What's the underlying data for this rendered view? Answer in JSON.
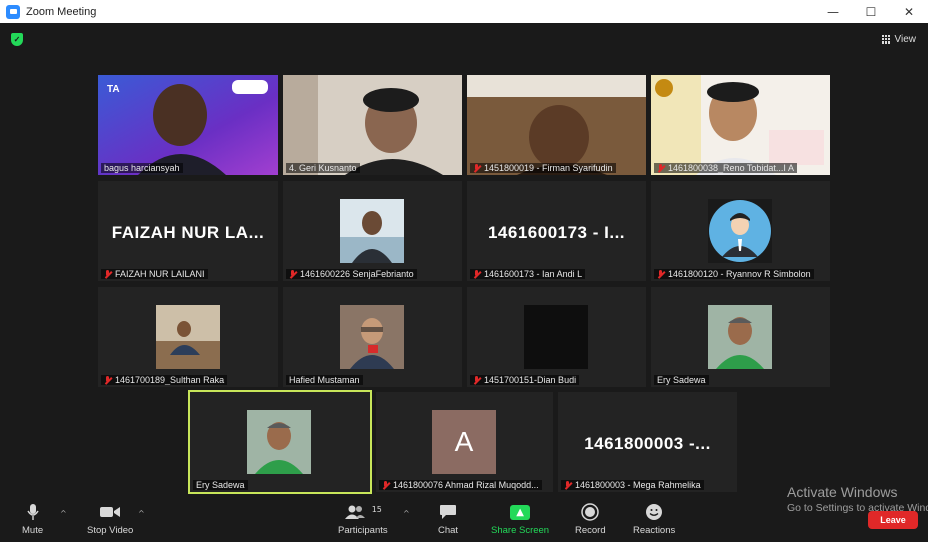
{
  "window": {
    "title": "Zoom Meeting",
    "controls": [
      "—",
      "☐",
      "✕"
    ]
  },
  "header": {
    "view_label": "View",
    "shield_icon": "shield-check-icon"
  },
  "participants": [
    {
      "name": "bagus harciansyah",
      "muted": false
    },
    {
      "name": "4. Geri Kusnanto",
      "muted": false
    },
    {
      "name": "1451800019 - Firman Syarifudin",
      "muted": true
    },
    {
      "name": "1461800038_Reno Tobidat...I A",
      "muted": true
    },
    {
      "name": "FAIZAH NUR LAILANI",
      "muted": true,
      "display": "FAIZAH NUR LA..."
    },
    {
      "name": "1461600226 SenjaFebrianto",
      "muted": true
    },
    {
      "name": "1461600173 - Ian Andi L",
      "muted": true,
      "display": "1461600173 - I..."
    },
    {
      "name": "1461800120 - Ryannov R Simbolon",
      "muted": true
    },
    {
      "name": "1461700189_Sulthan Raka",
      "muted": true
    },
    {
      "name": "Hafied Mustaman",
      "muted": false
    },
    {
      "name": "1451700151-Dian Budi",
      "muted": true
    },
    {
      "name": "Ery Sadewa",
      "muted": false
    },
    {
      "name": "Ery Sadewa",
      "muted": false,
      "active_speaker": true
    },
    {
      "name": "1461800076 Ahmad Rizal Muqodd...",
      "muted": true,
      "avatar_letter": "A"
    },
    {
      "name": "1461800003 - Mega Rahmelika",
      "muted": true,
      "display": "1461800003 -..."
    }
  ],
  "toolbar": {
    "mute": "Mute",
    "stop_video": "Stop Video",
    "participants": "Participants",
    "participants_count": "15",
    "chat": "Chat",
    "share_screen": "Share Screen",
    "record": "Record",
    "reactions": "Reactions",
    "leave": "Leave"
  },
  "watermark": {
    "line1": "Activate Windows",
    "line2": "Go to Settings to activate Windows."
  },
  "colors": {
    "share_green": "#23d959",
    "leave_red": "#e02828",
    "active_border": "#c8e65a"
  }
}
